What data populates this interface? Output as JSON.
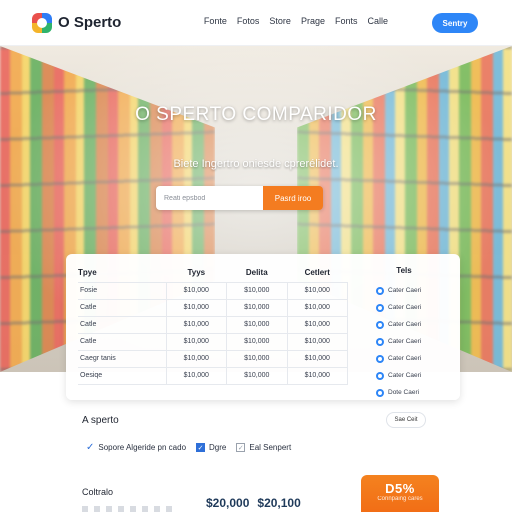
{
  "header": {
    "brand": "O Sperto",
    "nav": [
      "Fonte",
      "Fotos",
      "Store",
      "Prage",
      "Fonts",
      "Calle"
    ],
    "cta": "Sentry"
  },
  "hero": {
    "title": "O SPERTO COMPARIDOR",
    "subtitle": "Biete Ingertro oniesde cprerélidet.",
    "search_placeholder": "Reati epsbod",
    "search_button": "Pasrd iroo"
  },
  "table": {
    "headers": [
      "Tpye",
      "Tyys",
      "Delita",
      "Cetlert"
    ],
    "rows": [
      [
        "Fosie",
        "$10,000",
        "$10,000",
        "$10,000"
      ],
      [
        "Catle",
        "$10,000",
        "$10,000",
        "$10,000"
      ],
      [
        "Catle",
        "$10,000",
        "$10,000",
        "$10,000"
      ],
      [
        "Catle",
        "$10,000",
        "$10,000",
        "$10,000"
      ],
      [
        "Caegr tanis",
        "$10,000",
        "$10,000",
        "$10,000"
      ],
      [
        "Oesiqe",
        "$10,000",
        "$10,000",
        "$10,000"
      ]
    ]
  },
  "side": {
    "title": "Tels",
    "items": [
      "Cater Caeri",
      "Cater Caeri",
      "Cater Caeri",
      "Cater Caeri",
      "Cater Caeri",
      "Cater Caeri",
      "Dote Caeri"
    ],
    "button": "Sae Ceit"
  },
  "section": {
    "title": "A sperto",
    "checks": [
      "Sopore Algeride pn cado",
      "Dgre",
      "Eal Senpert"
    ]
  },
  "bottom": {
    "title": "Coltralo",
    "prices": [
      "$20,000",
      "$20,100"
    ],
    "promo_big": "D5%",
    "promo_small": "Connpaing cares"
  }
}
